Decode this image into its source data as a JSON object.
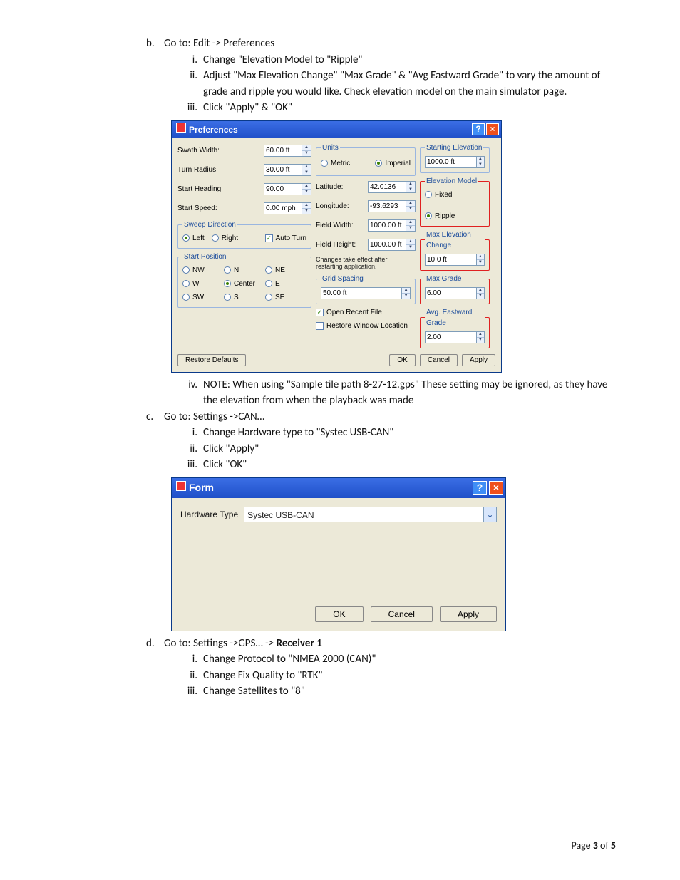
{
  "doc": {
    "b": {
      "marker": "b.",
      "text": "Go to: Edit -> Preferences"
    },
    "b_i": {
      "marker": "i.",
      "text": "Change \"Elevation Model to \"Ripple\""
    },
    "b_ii": {
      "marker": "ii.",
      "text": "Adjust \"Max Elevation Change\" \"Max Grade\" & \"Avg Eastward Grade\" to vary the amount of grade and ripple you would like. Check elevation model on the main simulator page."
    },
    "b_iii": {
      "marker": "iii.",
      "text": "Click \"Apply\" & \"OK\""
    },
    "b_iv": {
      "marker": "iv.",
      "text": "NOTE: When using \"Sample tile path 8-27-12.gps\"  These setting may be ignored,  as they have the elevation from when the playback was made"
    },
    "c": {
      "marker": "c.",
      "text": "Go to: Settings ->CAN…"
    },
    "c_i": {
      "marker": "i.",
      "text": "Change Hardware type to \"Systec USB-CAN\""
    },
    "c_ii": {
      "marker": "ii.",
      "text": "Click \"Apply\""
    },
    "c_iii": {
      "marker": "iii.",
      "text": "Click \"OK\""
    },
    "d": {
      "marker": "d.",
      "text_pre": "Go to: Settings ->GPS… -> ",
      "text_bold": "Receiver 1"
    },
    "d_i": {
      "marker": "i.",
      "text": "Change Protocol to \"NMEA 2000 (CAN)\""
    },
    "d_ii": {
      "marker": "ii.",
      "text": "Change Fix Quality to \"RTK\""
    },
    "d_iii": {
      "marker": "iii.",
      "text": "Change Satellites to \"8\""
    }
  },
  "prefs": {
    "title": "Preferences",
    "swath_label": "Swath Width:",
    "swath_value": "60.00 ft",
    "turn_label": "Turn Radius:",
    "turn_value": "30.00 ft",
    "head_label": "Start Heading:",
    "head_value": "90.00",
    "speed_label": "Start Speed:",
    "speed_value": "0.00 mph",
    "sweep_legend": "Sweep Direction",
    "sweep_left": "Left",
    "sweep_right": "Right",
    "sweep_auto": "Auto Turn",
    "startpos_legend": "Start Position",
    "sp": {
      "nw": "NW",
      "n": "N",
      "ne": "NE",
      "w": "W",
      "c": "Center",
      "e": "E",
      "sw": "SW",
      "s": "S",
      "se": "SE"
    },
    "units_legend": "Units",
    "units_metric": "Metric",
    "units_imperial": "Imperial",
    "lat_label": "Latitude:",
    "lat_value": "42.0136",
    "lon_label": "Longitude:",
    "lon_value": "-93.6293",
    "fw_label": "Field Width:",
    "fw_value": "1000.00 ft",
    "fh_label": "Field Height:",
    "fh_value": "1000.00 ft",
    "restart_note": "Changes take effect after restarting application.",
    "grid_legend": "Grid Spacing",
    "grid_value": "50.00 ft",
    "open_recent": "Open Recent File",
    "restore_win": "Restore Window Location",
    "se_legend": "Starting Elevation",
    "se_value": "1000.0 ft",
    "em_legend": "Elevation Model",
    "em_fixed": "Fixed",
    "em_ripple": "Ripple",
    "mec_legend": "Max Elevation Change",
    "mec_value": "10.0 ft",
    "mg_legend": "Max Grade",
    "mg_value": "6.00",
    "aeg_legend": "Avg. Eastward Grade",
    "aeg_value": "2.00",
    "restore_defaults": "Restore Defaults",
    "ok": "OK",
    "cancel": "Cancel",
    "apply": "Apply"
  },
  "form": {
    "title": "Form",
    "hw_label": "Hardware Type",
    "hw_value": "Systec USB-CAN",
    "ok": "OK",
    "cancel": "Cancel",
    "apply": "Apply"
  },
  "footer": {
    "pre": "Page ",
    "cur": "3",
    "mid": " of ",
    "total": "5"
  }
}
